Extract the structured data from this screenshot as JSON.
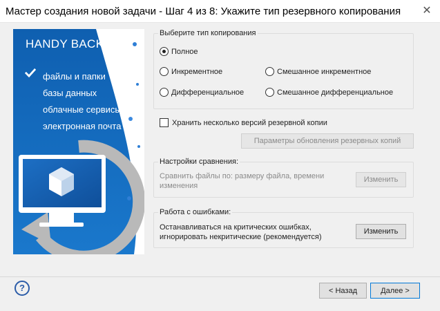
{
  "window": {
    "title": "Мастер создания новой задачи - Шаг 4 из 8: Укажите тип резервного копирования",
    "close_glyph": "✕"
  },
  "banner": {
    "brand": "HANDY BACKUP",
    "features": [
      "файлы и папки",
      "базы данных",
      "облачные сервисы",
      "электронная почта"
    ],
    "colors": {
      "blue": "#1464b4",
      "light_blue": "#1a7fd0",
      "ring": "#b4b4b4"
    }
  },
  "backup_type": {
    "title": "Выберите тип копирования",
    "options": {
      "full": "Полное",
      "incremental": "Инкрементное",
      "mixed_incremental": "Смешанное инкрементное",
      "differential": "Дифференциальное",
      "mixed_differential": "Смешанное дифференциальное"
    },
    "selected": "full"
  },
  "versions": {
    "checkbox_label": "Хранить несколько версий резервной копии",
    "checked": false,
    "update_params_button": "Параметры обновления резервных копий"
  },
  "comparison": {
    "title": "Настройки сравнения:",
    "description": "Сравнить файлы по: размеру файла, времени изменения",
    "change_button": "Изменить"
  },
  "errors": {
    "title": "Работа с ошибками:",
    "description": "Останавливаться на критических ошибках, игнорировать некритические (рекомендуется)",
    "change_button": "Изменить"
  },
  "footer": {
    "help_glyph": "?",
    "back_button": "< Назад",
    "next_button": "Далее >"
  }
}
